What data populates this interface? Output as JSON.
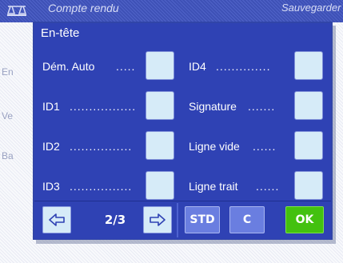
{
  "background": {
    "title": "Compte rendu",
    "title_right": "Sauvegarder",
    "list_labels": [
      "En",
      "Ve",
      "Ba"
    ]
  },
  "dialog": {
    "title": "En-tête",
    "left_fields": [
      {
        "label": "Dém. Auto",
        "dots": "....."
      },
      {
        "label": "ID1",
        "dots": "................."
      },
      {
        "label": "ID2",
        "dots": "................"
      },
      {
        "label": "ID3",
        "dots": "................"
      }
    ],
    "right_fields": [
      {
        "label": "ID4",
        "dots": ".............."
      },
      {
        "label": "Signature",
        "dots": "......."
      },
      {
        "label": "Ligne vide",
        "dots": "......"
      },
      {
        "label": "Ligne trait",
        "dots": "......"
      }
    ],
    "footer": {
      "prev_icon": "arrow-left-icon",
      "page_indicator": "2/3",
      "next_icon": "arrow-right-icon",
      "std_label": "STD",
      "c_label": "C",
      "ok_label": "OK"
    }
  },
  "colors": {
    "accent": "#2f42b4",
    "field_bg": "#d6ebf8",
    "ok_green": "#43c10f"
  }
}
